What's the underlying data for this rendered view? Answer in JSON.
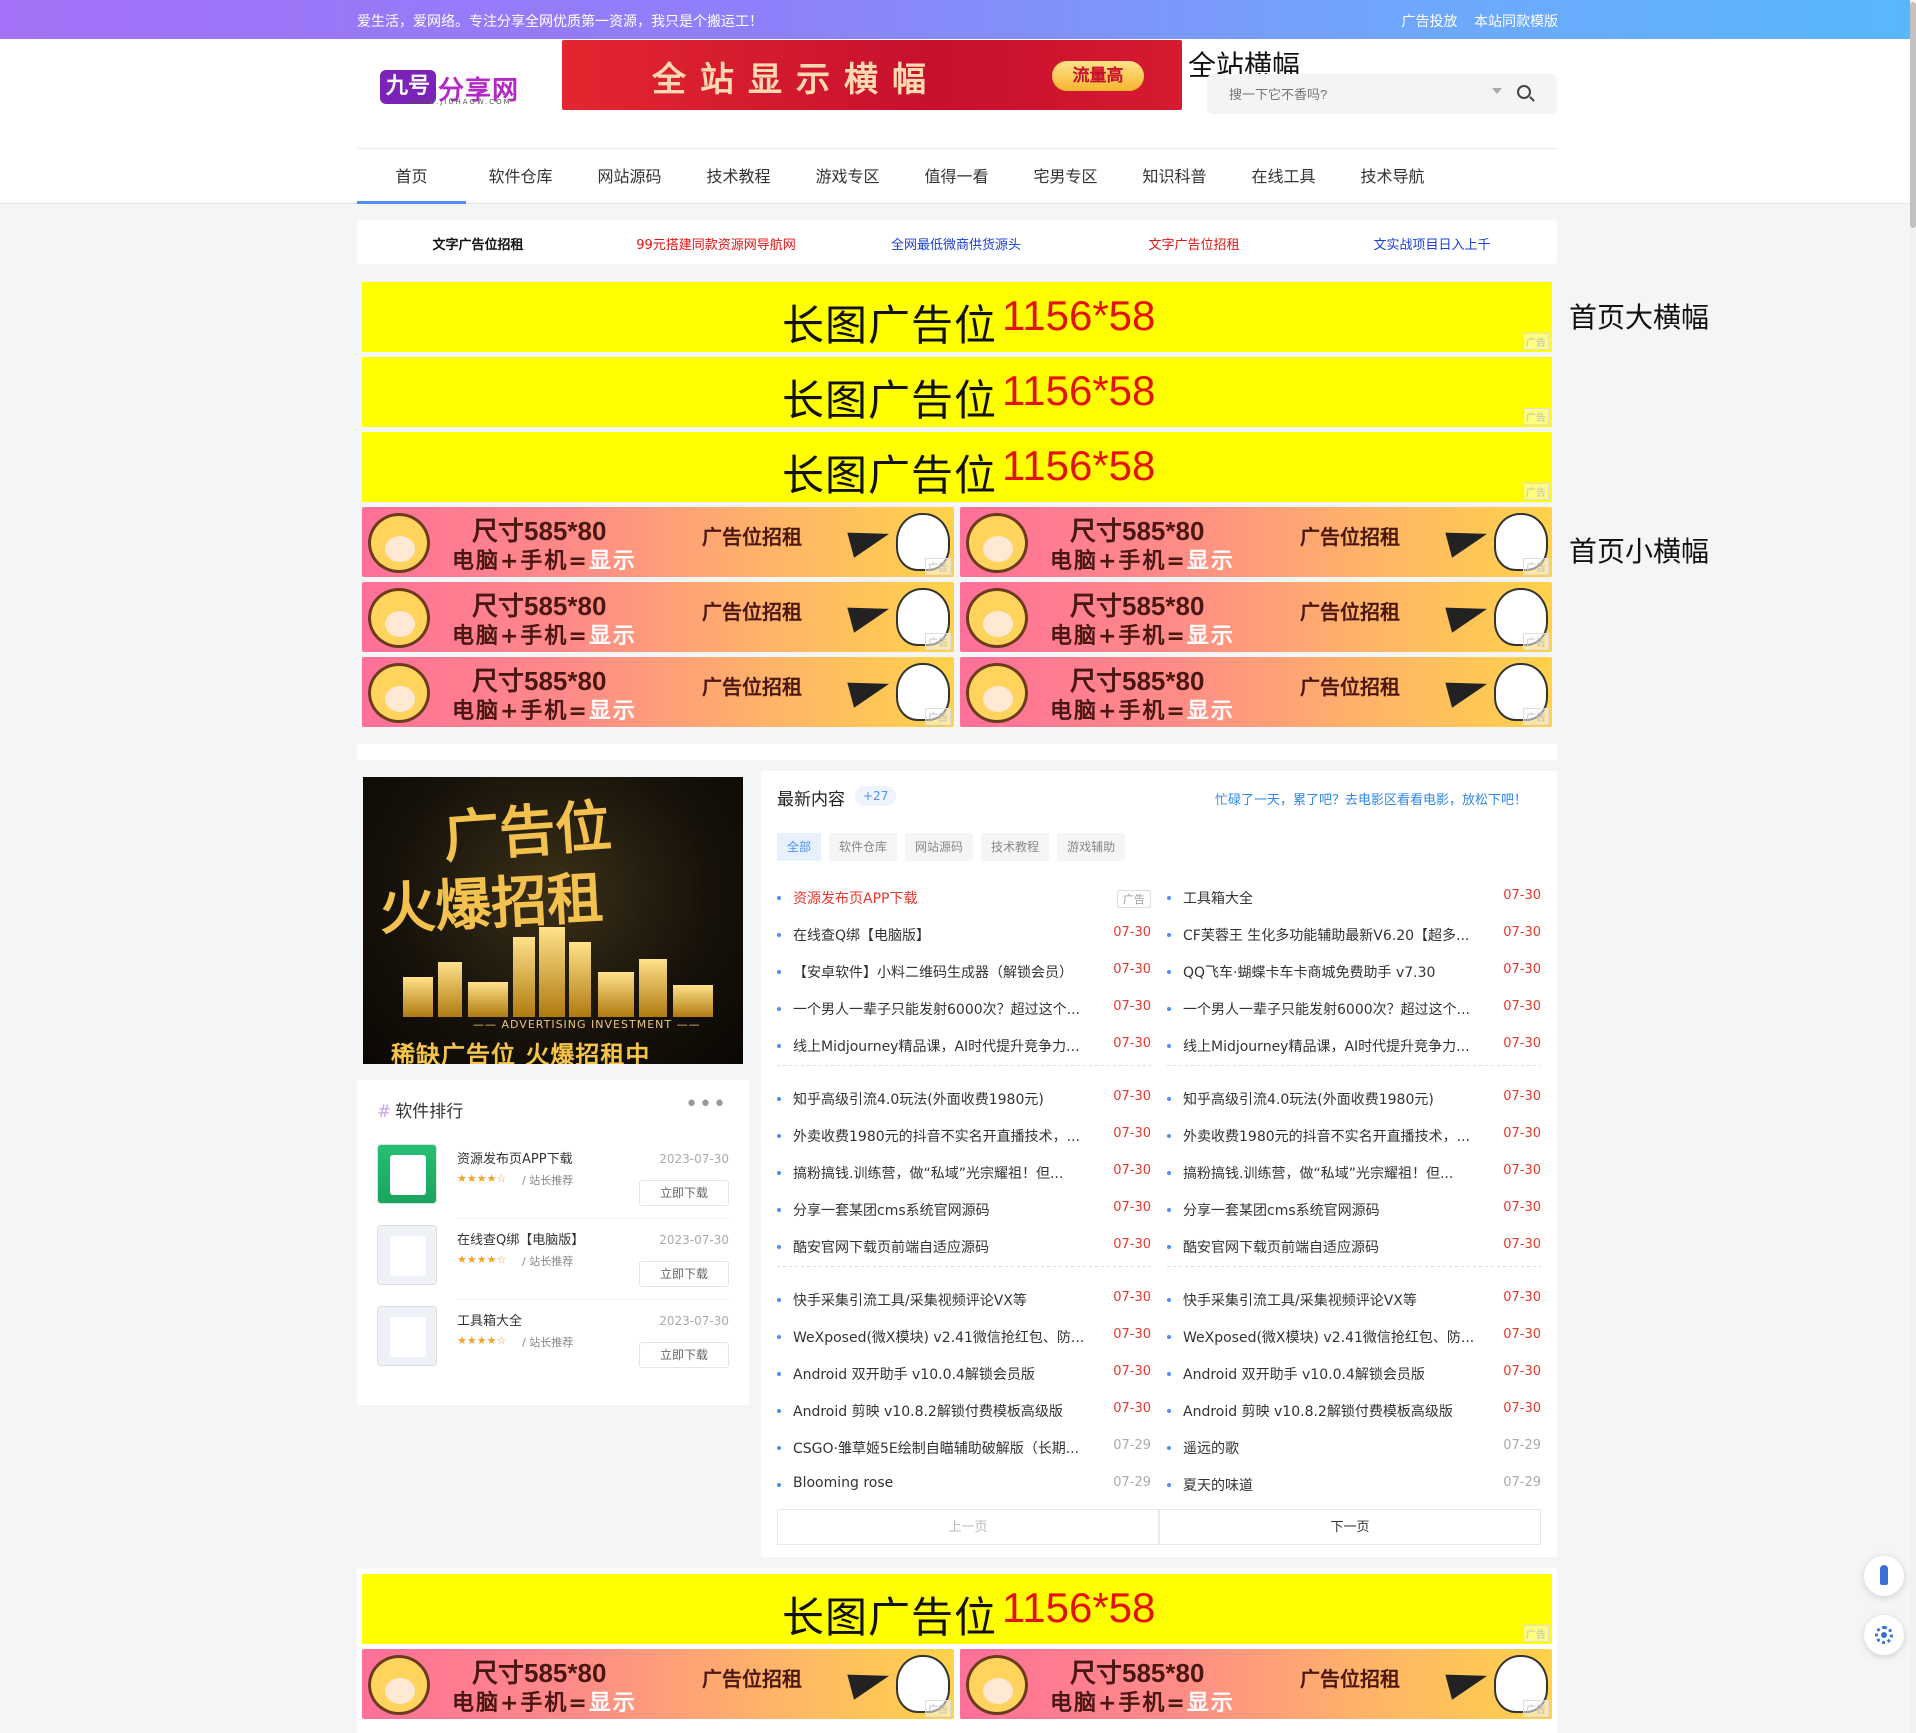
{
  "topbar": {
    "slogan": "爱生活，爱网络。专注分享全网优质第一资源，我只是个搬运工！",
    "links": [
      "广告投放",
      "本站同款模版"
    ]
  },
  "logo": {
    "mark": "九号",
    "text": "分享网",
    "sub": "WWW.JIUHAOW.COM"
  },
  "top_banner": {
    "text": "全站显示横幅",
    "pill": "流量高"
  },
  "annotations": {
    "top": "全站横幅",
    "big": "首页大横幅",
    "small": "首页小横幅"
  },
  "search": {
    "placeholder": "搜一下它不香吗?"
  },
  "nav": [
    "首页",
    "软件仓库",
    "网站源码",
    "技术教程",
    "游戏专区",
    "值得一看",
    "宅男专区",
    "知识科普",
    "在线工具",
    "技术导航"
  ],
  "text_ads": [
    {
      "text": "文字广告位招租",
      "color": "#111111"
    },
    {
      "text": "99元搭建同款资源网导航网",
      "color": "#e41111"
    },
    {
      "text": "全网最低微商供货源头",
      "color": "#1a3fd6"
    },
    {
      "text": "文字广告位招租",
      "color": "#e41111"
    },
    {
      "text": "文实战项目日入上千",
      "color": "#1a3fd6"
    }
  ],
  "big_banner": {
    "label": "长图广告位",
    "size": "1156*58",
    "tag": "广告"
  },
  "small_banner": {
    "line1": "尺寸585*80",
    "line2a": "电脑+手机=",
    "line2b": "显示",
    "line3": "广告位招租",
    "tag": "广告"
  },
  "gold_ad": {
    "h1": "广告位",
    "h2": "火爆招租",
    "line": "—— ADVERTISING INVESTMENT ——",
    "foot": "稀缺广告位 火爆招租中"
  },
  "rank": {
    "title": "软件排行",
    "hash": "#",
    "dots": "•••",
    "items": [
      {
        "name": "资源发布页APP下载",
        "date": "2023-07-30",
        "stars": "★★★★☆",
        "rec": "/ 站长推荐",
        "btn": "立即下载"
      },
      {
        "name": "在线查Q绑【电脑版】",
        "date": "2023-07-30",
        "stars": "★★★★☆",
        "rec": "/ 站长推荐",
        "btn": "立即下载"
      },
      {
        "name": "工具箱大全",
        "date": "2023-07-30",
        "stars": "★★★★☆",
        "rec": "/ 站长推荐",
        "btn": "立即下载"
      }
    ]
  },
  "latest": {
    "title": "最新内容",
    "badge": "+27",
    "hint": "忙碌了一天，累了吧？去电影区看看电影，放松下吧！",
    "tabs": [
      "全部",
      "软件仓库",
      "网站源码",
      "技术教程",
      "游戏辅助"
    ],
    "left": [
      {
        "t": "资源发布页APP下载",
        "d": "广告",
        "ad": true
      },
      {
        "t": "在线查Q绑【电脑版】",
        "d": "07-30"
      },
      {
        "t": "【安卓软件】小料二维码生成器（解锁会员）",
        "d": "07-30"
      },
      {
        "t": "一个男人一辈子只能发射6000次？超过这个...",
        "d": "07-30"
      },
      {
        "t": "线上Midjourney精品课，AI时代提升竞争力...",
        "d": "07-30"
      },
      {
        "t": "知乎高级引流4.0玩法(外面收费1980元)",
        "d": "07-30"
      },
      {
        "t": "外卖收费1980元的抖音不实名开直播技术，...",
        "d": "07-30"
      },
      {
        "t": "搞粉搞钱.训练营，做“私域”光宗耀祖！但...",
        "d": "07-30"
      },
      {
        "t": "分享一套某团cms系统官网源码",
        "d": "07-30"
      },
      {
        "t": "酷安官网下载页前端自适应源码",
        "d": "07-30"
      },
      {
        "t": "快手采集引流工具/采集视频评论VX等",
        "d": "07-30"
      },
      {
        "t": "WeXposed(微X模块) v2.41微信抢红包、防...",
        "d": "07-30"
      },
      {
        "t": "Android 双开助手 v10.0.4解锁会员版",
        "d": "07-30"
      },
      {
        "t": "Android 剪映 v10.8.2解锁付费模板高级版",
        "d": "07-30"
      },
      {
        "t": "CSGO·雏草姬5E绘制自瞄辅助破解版（长期...",
        "d": "07-29",
        "grey": true
      },
      {
        "t": "Blooming rose",
        "d": "07-29",
        "grey": true
      }
    ],
    "right": [
      {
        "t": "工具箱大全",
        "d": "07-30"
      },
      {
        "t": "CF芙蓉王 生化多功能辅助最新V6.20【超多...",
        "d": "07-30"
      },
      {
        "t": "QQ飞车·蝴蝶卡车卡商城免费助手 v7.30",
        "d": "07-30"
      },
      {
        "t": "一个男人一辈子只能发射6000次？超过这个...",
        "d": "07-30"
      },
      {
        "t": "线上Midjourney精品课，AI时代提升竞争力...",
        "d": "07-30"
      },
      {
        "t": "知乎高级引流4.0玩法(外面收费1980元)",
        "d": "07-30"
      },
      {
        "t": "外卖收费1980元的抖音不实名开直播技术，...",
        "d": "07-30"
      },
      {
        "t": "搞粉搞钱.训练营，做“私域”光宗耀祖！但...",
        "d": "07-30"
      },
      {
        "t": "分享一套某团cms系统官网源码",
        "d": "07-30"
      },
      {
        "t": "酷安官网下载页前端自适应源码",
        "d": "07-30"
      },
      {
        "t": "快手采集引流工具/采集视频评论VX等",
        "d": "07-30"
      },
      {
        "t": "WeXposed(微X模块) v2.41微信抢红包、防...",
        "d": "07-30"
      },
      {
        "t": "Android 双开助手 v10.0.4解锁会员版",
        "d": "07-30"
      },
      {
        "t": "Android 剪映 v10.8.2解锁付费模板高级版",
        "d": "07-30"
      },
      {
        "t": "遥远的歌",
        "d": "07-29",
        "grey": true
      },
      {
        "t": "夏天的味道",
        "d": "07-29",
        "grey": true
      }
    ],
    "pager": {
      "prev": "上一页",
      "next": "下一页"
    }
  },
  "colors": {
    "accent": "#4e8ff7",
    "red": "#e5372c",
    "banner_yellow": "#ffff00"
  },
  "floating": [
    "rocket-icon",
    "gear-icon"
  ]
}
